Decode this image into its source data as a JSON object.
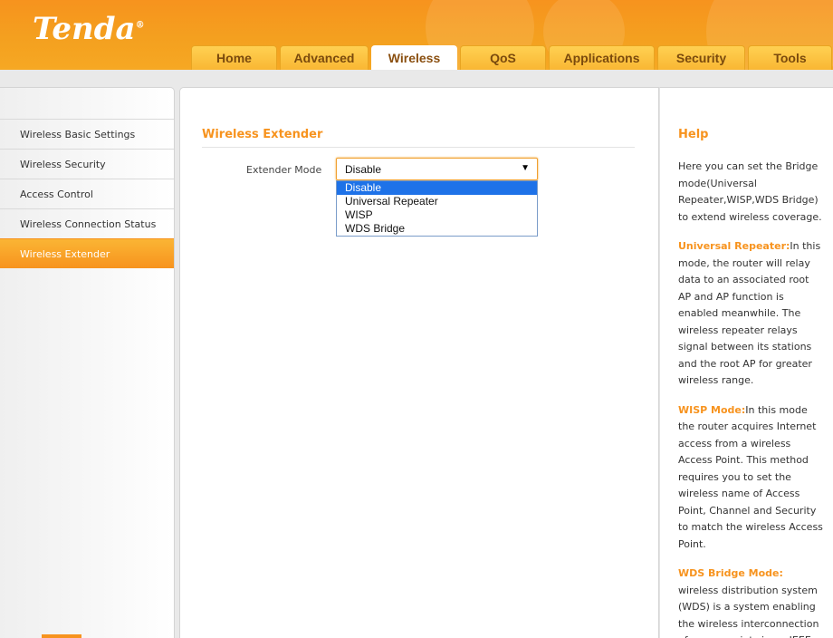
{
  "brand": {
    "logo_text": "Tenda",
    "mark": "®",
    "accent_color": "#f7931e"
  },
  "nav": {
    "tabs": [
      {
        "label": "Home"
      },
      {
        "label": "Advanced"
      },
      {
        "label": "Wireless",
        "active": true
      },
      {
        "label": "QoS"
      },
      {
        "label": "Applications"
      },
      {
        "label": "Security"
      },
      {
        "label": "Tools"
      }
    ]
  },
  "sidebar": {
    "items": [
      {
        "label": "Wireless Basic Settings"
      },
      {
        "label": "Wireless Security"
      },
      {
        "label": "Access Control"
      },
      {
        "label": "Wireless Connection Status"
      },
      {
        "label": "Wireless Extender",
        "active": true
      }
    ]
  },
  "main": {
    "section_title": "Wireless Extender",
    "extender_mode": {
      "label": "Extender Mode",
      "selected": "Disable",
      "options": [
        "Disable",
        "Universal Repeater",
        "WISP",
        "WDS Bridge"
      ]
    }
  },
  "help": {
    "title": "Help",
    "intro": "Here you can set the Bridge mode(Universal Repeater,WISP,WDS Bridge) to extend wireless coverage.",
    "sections": [
      {
        "term": "Universal Repeater:",
        "text": "In this mode, the router will relay data to an associated root AP and AP function is enabled meanwhile. The wireless repeater relays signal between its stations and the root AP for greater wireless range."
      },
      {
        "term": "WISP Mode:",
        "text": "In this mode the router acquires Internet access from a wireless Access Point. This method requires you to set the wireless name of Access Point, Channel and Security to match the wireless Access Point."
      },
      {
        "term": "WDS Bridge Mode:",
        "text": "wireless distribution system (WDS) is a system enabling the wireless interconnection of access points in an IEEE"
      }
    ]
  }
}
